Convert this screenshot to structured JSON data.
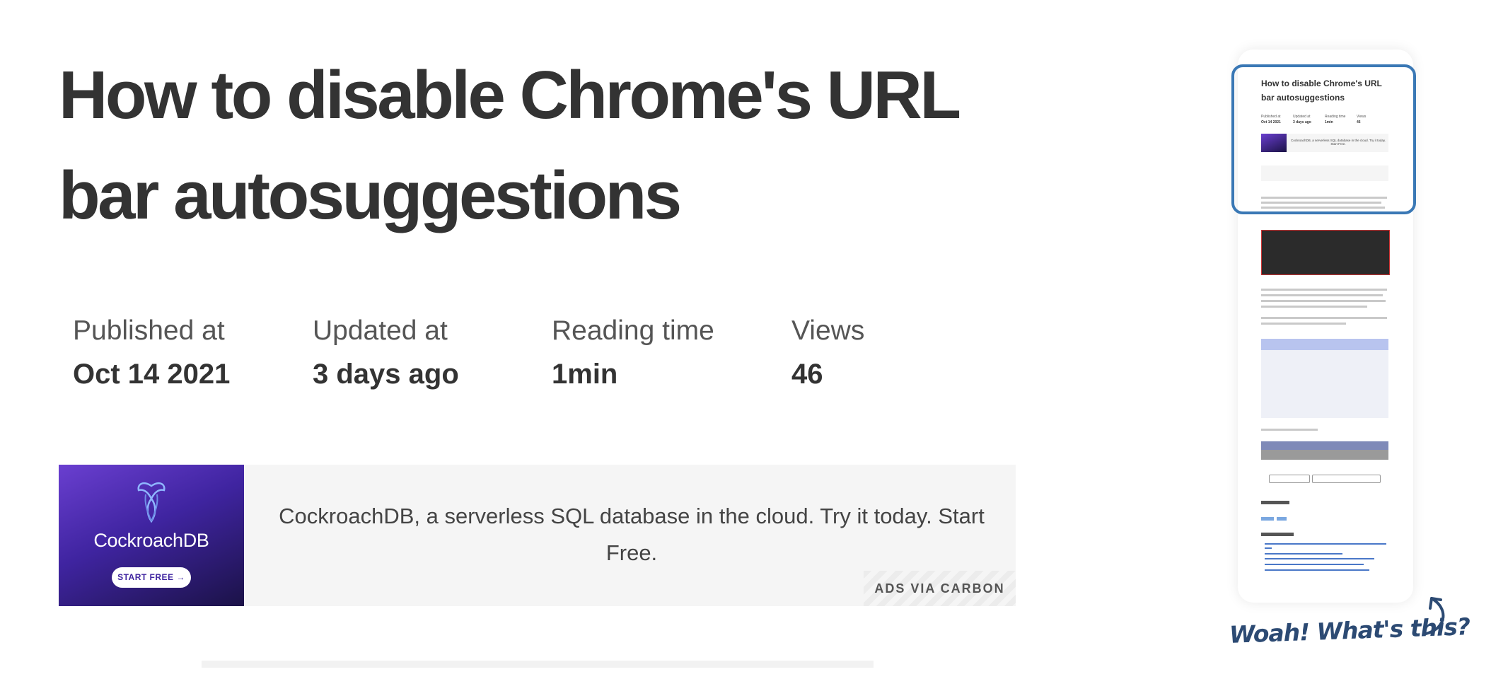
{
  "article": {
    "title": "How to disable Chrome's URL bar autosuggestions",
    "meta": [
      {
        "label": "Published at",
        "value": "Oct 14 2021"
      },
      {
        "label": "Updated at",
        "value": "3 days ago"
      },
      {
        "label": "Reading time",
        "value": "1min"
      },
      {
        "label": "Views",
        "value": "46"
      }
    ]
  },
  "ad": {
    "brand": "CockroachDB",
    "cta": "START FREE",
    "text": "CockroachDB, a serverless SQL database in the cloud. Try it today. Start Free.",
    "via": "ADS VIA CARBON"
  },
  "minimap": {
    "caption": "Woah! What's this?",
    "accent": "#3a78b5"
  },
  "colors": {
    "text": "#333333",
    "ad_purple": "#5b32c4",
    "caption": "#2c4a73"
  }
}
